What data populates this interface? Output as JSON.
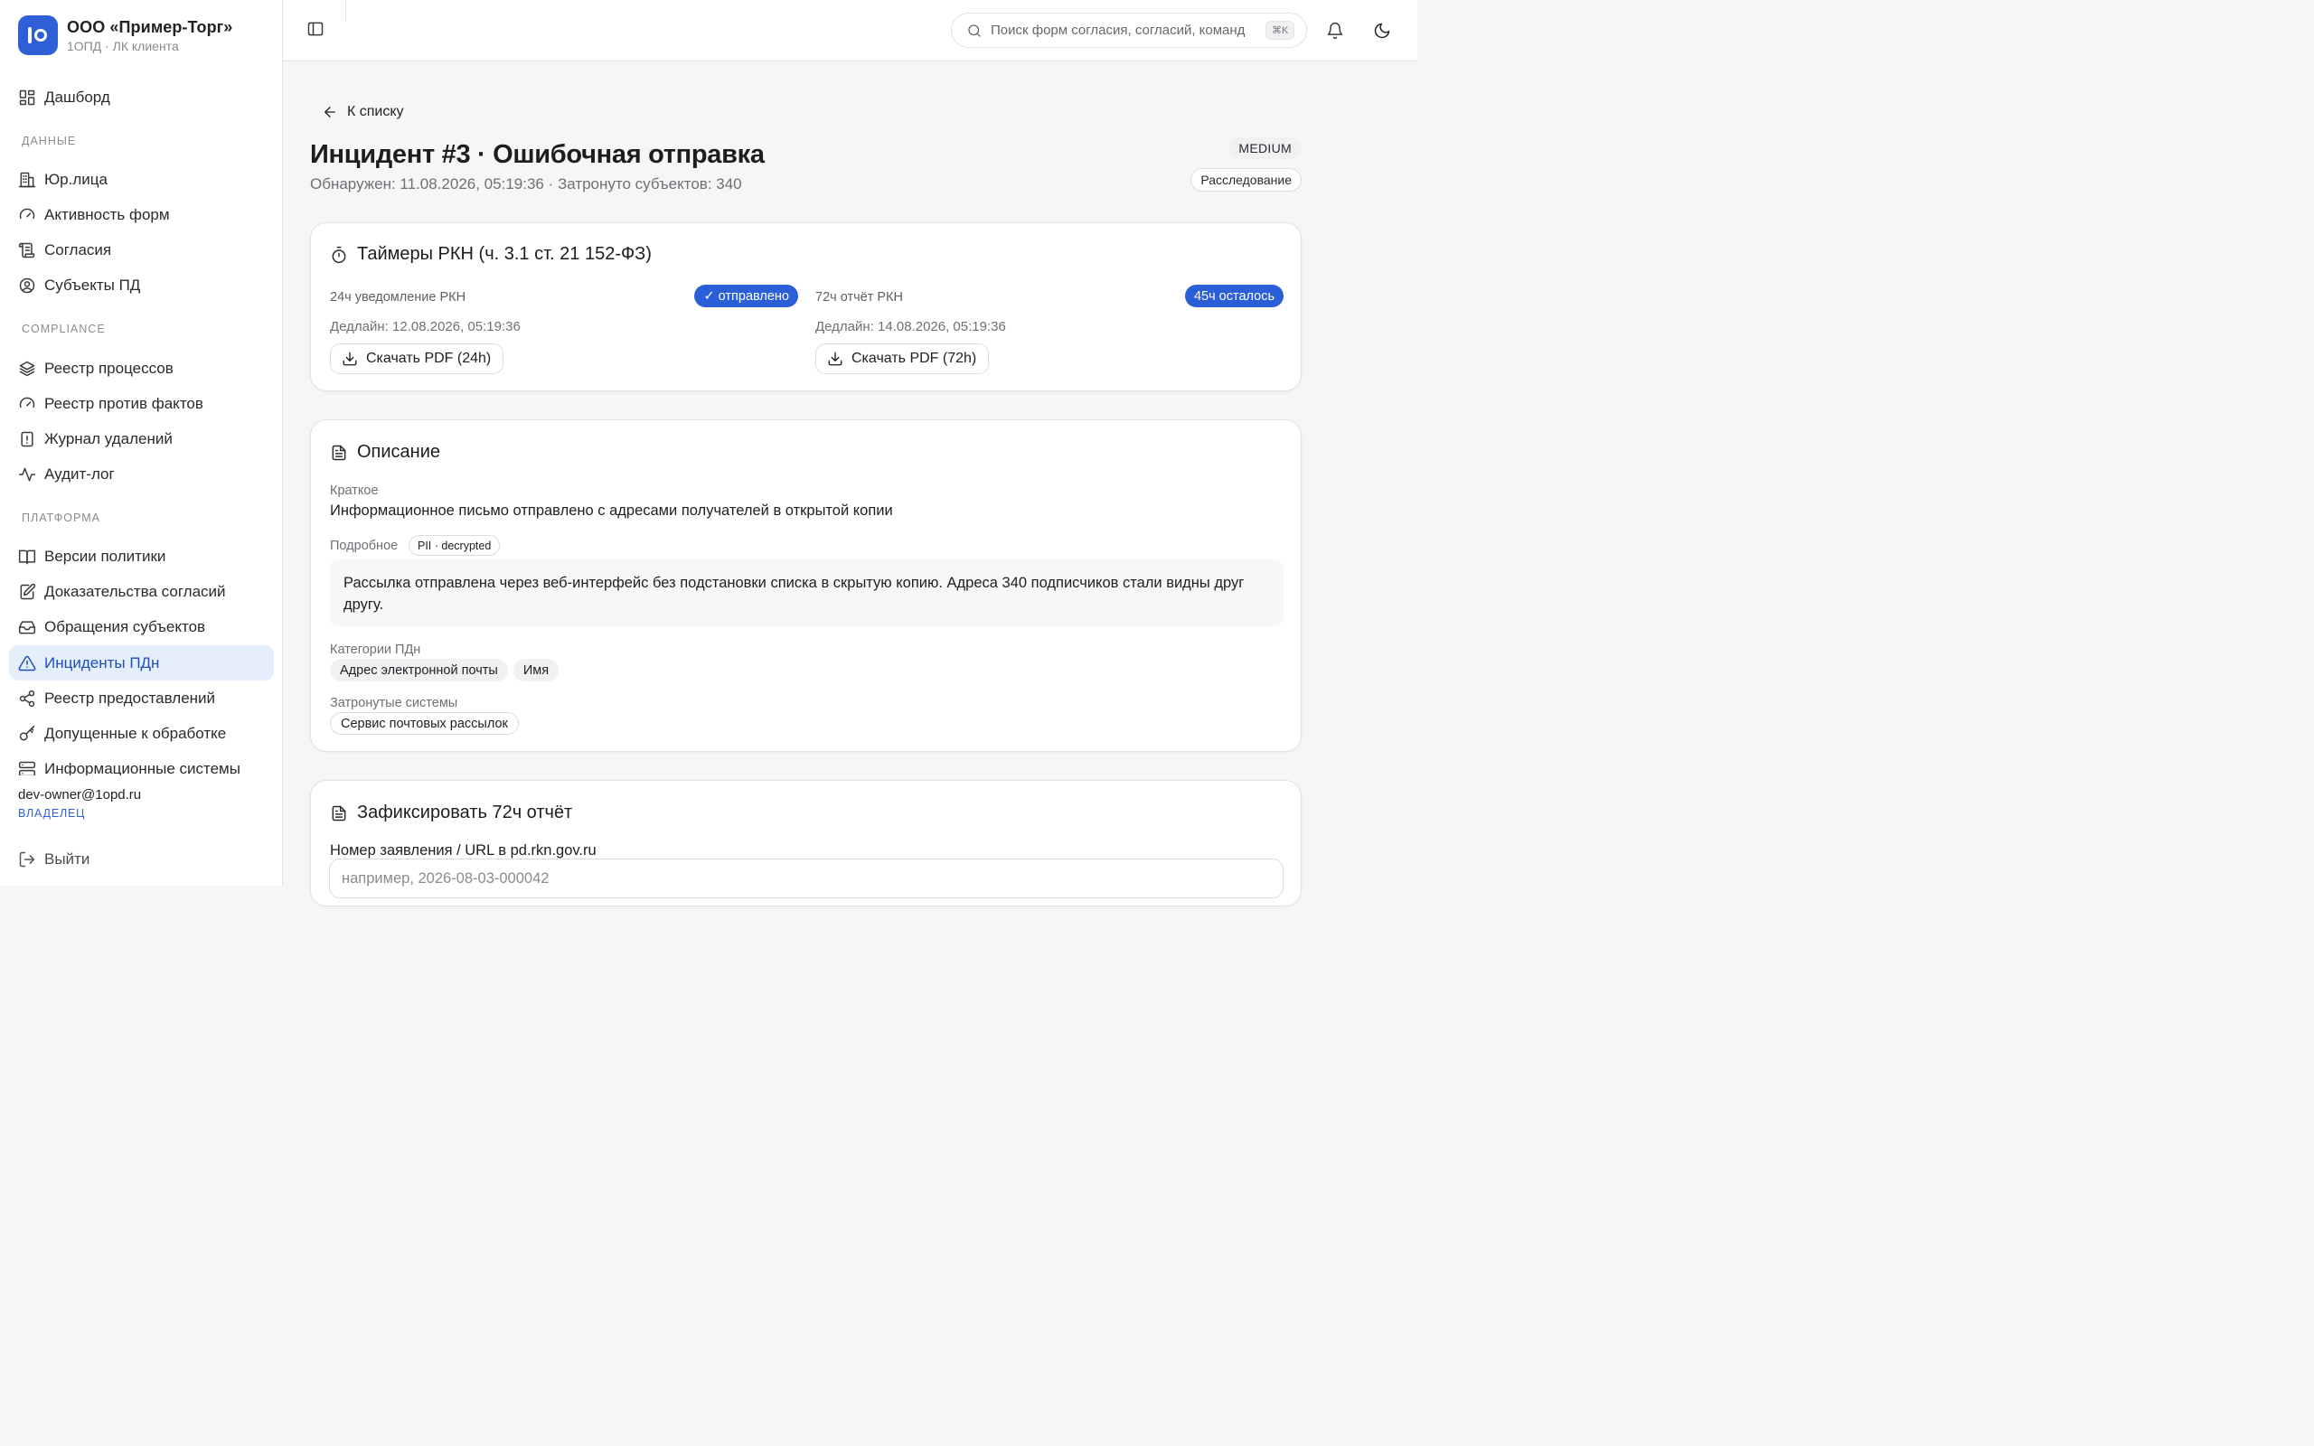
{
  "org": {
    "name": "ООО «Пример-Торг»",
    "subtitle": "1ОПД · ЛК клиента"
  },
  "sidebar": {
    "dashboard": {
      "label": "Дашборд",
      "icon": "dashboard-icon"
    },
    "sections": [
      {
        "title": "ДАННЫЕ",
        "items": [
          {
            "label": "Юр.лица",
            "icon": "building-icon"
          },
          {
            "label": "Активность форм",
            "icon": "gauge-icon"
          },
          {
            "label": "Согласия",
            "icon": "scroll-icon"
          },
          {
            "label": "Субъекты ПД",
            "icon": "user-circle-icon"
          }
        ]
      },
      {
        "title": "COMPLIANCE",
        "items": [
          {
            "label": "Реестр процессов",
            "icon": "layers-icon"
          },
          {
            "label": "Реестр против фактов",
            "icon": "gauge-icon"
          },
          {
            "label": "Журнал удалений",
            "icon": "file-alert-icon"
          },
          {
            "label": "Аудит-лог",
            "icon": "activity-icon"
          }
        ]
      },
      {
        "title": "ПЛАТФОРМА",
        "items": [
          {
            "label": "Версии политики",
            "icon": "book-icon"
          },
          {
            "label": "Доказательства согласий",
            "icon": "file-edit-icon"
          },
          {
            "label": "Обращения субъектов",
            "icon": "inbox-icon"
          },
          {
            "label": "Инциденты ПДн",
            "icon": "alert-triangle-icon",
            "active": true
          },
          {
            "label": "Реестр предоставлений",
            "icon": "share-icon"
          },
          {
            "label": "Допущенные к обработке",
            "icon": "key-icon"
          },
          {
            "label": "Информационные системы",
            "icon": "server-icon"
          }
        ]
      }
    ],
    "user": {
      "email": "dev-owner@1opd.ru",
      "role": "ВЛАДЕЛЕЦ"
    },
    "logout": "Выйти"
  },
  "topbar": {
    "search_placeholder": "Поиск форм согласия, согласий, команд",
    "search_shortcut": "⌘K"
  },
  "incident": {
    "back": "К списку",
    "title": "Инцидент #3 · Ошибочная отправка",
    "meta": "Обнаружен: 11.08.2026, 05:19:36 · Затронуто субъектов: 340",
    "severity": "MEDIUM",
    "status": "Расследование"
  },
  "timers": {
    "title": "Таймеры РКН (ч. 3.1 ст. 21 152-ФЗ)",
    "items": [
      {
        "label": "24ч уведомление РКН",
        "status": "✓ отправлено",
        "deadline": "Дедлайн: 12.08.2026, 05:19:36",
        "button": "Скачать PDF (24h)"
      },
      {
        "label": "72ч отчёт РКН",
        "status": "45ч осталось",
        "deadline": "Дедлайн: 14.08.2026, 05:19:36",
        "button": "Скачать PDF (72h)"
      }
    ]
  },
  "description": {
    "title": "Описание",
    "short_label": "Краткое",
    "short_value": "Информационное письмо отправлено с адресами получателей в открытой копии",
    "detail_label": "Подробное",
    "pii_badge": "PII · decrypted",
    "detail_value": "Рассылка отправлена через веб-интерфейс без подстановки списка в скрытую копию. Адреса 340 подписчиков стали видны друг другу.",
    "categories_label": "Категории ПДн",
    "categories": [
      "Адрес электронной почты",
      "Имя"
    ],
    "systems_label": "Затронутые системы",
    "systems": [
      "Сервис почтовых рассылок"
    ]
  },
  "report": {
    "title": "Зафиксировать 72ч отчёт",
    "field_label": "Номер заявления / URL в pd.rkn.gov.ru",
    "field_value": "",
    "field_placeholder": "например, 2026-08-03-000042"
  },
  "colors": {
    "accent": "#2f5fd6",
    "active_bg": "#e5eefb",
    "pill": "#2b5fd8"
  }
}
